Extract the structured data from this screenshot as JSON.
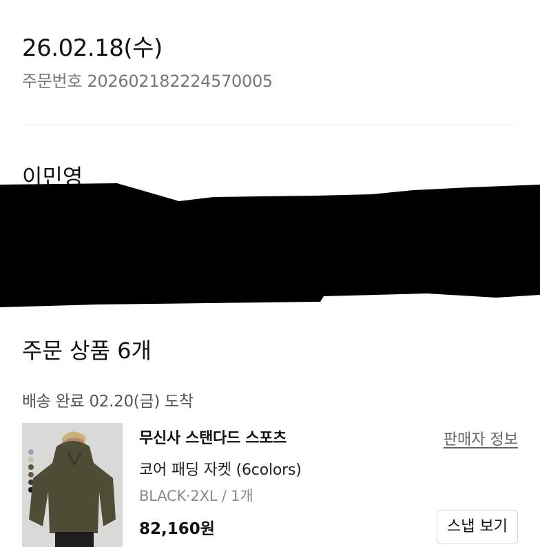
{
  "order": {
    "date": "26.02.18(수)",
    "number": "주문번호 20260218222457000​5"
  },
  "recipient": {
    "name": "이민영"
  },
  "products_section": {
    "title": "주문 상품 6개",
    "delivery_status": "배송 완료 02.20(금) 도착"
  },
  "product": {
    "brand": "무신사 스탠다드 스포츠",
    "seller_info_label": "판매자 정보",
    "name": "코어 패딩 자켓 (6colors)",
    "option": "BLACK·2XL / 1개",
    "price": "82,160원",
    "snap_button_label": "스냅 보기",
    "image_color": "#5a5a3e"
  },
  "colors": {
    "text_primary": "#111111",
    "text_secondary": "#777777",
    "divider": "#ececec",
    "redaction": "#000000"
  }
}
